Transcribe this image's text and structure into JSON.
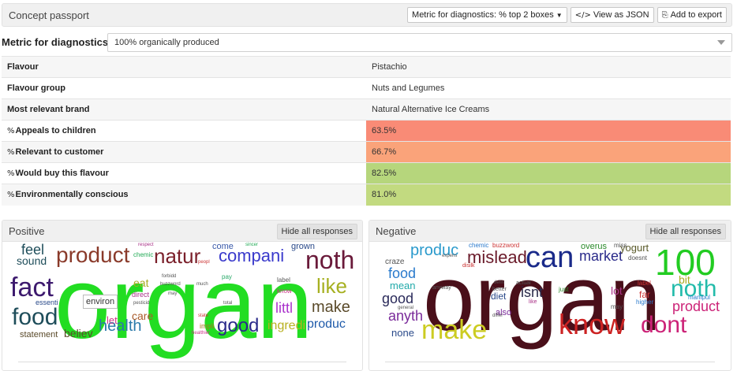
{
  "header": {
    "title": "Concept passport",
    "metric_select_label": "Metric for diagnostics: % top 2 boxes",
    "view_json_label": "View as JSON",
    "export_label": "Add to export"
  },
  "metric": {
    "label": "Metric for diagnostics:",
    "value": "100% organically produced"
  },
  "rows": [
    {
      "key": "Flavour",
      "value": "Pistachio"
    },
    {
      "key": "Flavour group",
      "value": "Nuts and Legumes"
    },
    {
      "key": "Most relevant brand",
      "value": "Natural Alternative Ice Creams"
    },
    {
      "key": "Appeals to children",
      "value": "63.5%",
      "color": "#f98b76"
    },
    {
      "key": "Relevant to customer",
      "value": "66.7%",
      "color": "#faa37a"
    },
    {
      "key": "Would buy this flavour",
      "value": "82.5%",
      "color": "#b6d67c"
    },
    {
      "key": "Environmentally conscious",
      "value": "81.0%",
      "color": "#c2da80"
    }
  ],
  "positive": {
    "title": "Positive",
    "hide_label": "Hide all responses",
    "tooltip": "environ",
    "words": [
      {
        "t": "organ",
        "c": "#22dd22"
      },
      {
        "t": "fact",
        "c": "#3d1a6e"
      },
      {
        "t": "food",
        "c": "#1e4d5a"
      },
      {
        "t": "product",
        "c": "#8a3a2a"
      },
      {
        "t": "natur",
        "c": "#7a1f2a"
      },
      {
        "t": "noth",
        "c": "#6a1a3a"
      },
      {
        "t": "compani",
        "c": "#3a3acc"
      },
      {
        "t": "feel",
        "c": "#1e4d5a"
      },
      {
        "t": "sound",
        "c": "#1e4d5a"
      },
      {
        "t": "like",
        "c": "#a6b020"
      },
      {
        "t": "make",
        "c": "#5a4a2a"
      },
      {
        "t": "good",
        "c": "#2a2a8a"
      },
      {
        "t": "health",
        "c": "#2a7aaa"
      },
      {
        "t": "littl",
        "c": "#aa33cc"
      },
      {
        "t": "ingredi",
        "c": "#b8b020"
      },
      {
        "t": "produc",
        "c": "#1e5aaa"
      },
      {
        "t": "believ",
        "c": "#5a4a2a"
      },
      {
        "t": "statement",
        "c": "#5a4a2a"
      },
      {
        "t": "care",
        "c": "#aa5a2a"
      },
      {
        "t": "let",
        "c": "#cc3388"
      },
      {
        "t": "eat",
        "c": "#aaaa22"
      },
      {
        "t": "direct",
        "c": "#aa3388"
      },
      {
        "t": "come",
        "c": "#3a5aaa"
      },
      {
        "t": "grown",
        "c": "#2a4a8a"
      },
      {
        "t": "essenti",
        "c": "#2a4a8a"
      },
      {
        "t": "label",
        "c": "#555555"
      },
      {
        "t": "know",
        "c": "#cc3388"
      },
      {
        "t": "pay",
        "c": "#2aaa6a"
      },
      {
        "t": "chemic",
        "c": "#22aa55"
      },
      {
        "t": "respect",
        "c": "#aa3388"
      },
      {
        "t": "sincer",
        "c": "#22aa55"
      },
      {
        "t": "peopl",
        "c": "#cc3333"
      },
      {
        "t": "buzzword",
        "c": "#555555"
      },
      {
        "t": "much",
        "c": "#555555"
      },
      {
        "t": "may",
        "c": "#555555"
      },
      {
        "t": "impli",
        "c": "#aa7722"
      },
      {
        "t": "pesticid",
        "c": "#555555"
      },
      {
        "t": "healthier",
        "c": "#cc3388"
      },
      {
        "t": "total",
        "c": "#555555"
      },
      {
        "t": "state",
        "c": "#cc3333"
      },
      {
        "t": "forbidd",
        "c": "#555555"
      }
    ]
  },
  "negative": {
    "title": "Negative",
    "hide_label": "Hide all responses",
    "words": [
      {
        "t": "organ",
        "c": "#4a0f1a"
      },
      {
        "t": "can",
        "c": "#1a2a8a"
      },
      {
        "t": "100",
        "c": "#22cc22"
      },
      {
        "t": "know",
        "c": "#cc2222"
      },
      {
        "t": "dont",
        "c": "#cc2277"
      },
      {
        "t": "make",
        "c": "#cccc22"
      },
      {
        "t": "noth",
        "c": "#22bbaa"
      },
      {
        "t": "product",
        "c": "#cc2277"
      },
      {
        "t": "mislead",
        "c": "#6a1a2a"
      },
      {
        "t": "produc",
        "c": "#2a9acc"
      },
      {
        "t": "market",
        "c": "#2a2a8a"
      },
      {
        "t": "food",
        "c": "#2a7acc"
      },
      {
        "t": "good",
        "c": "#2a2a5a"
      },
      {
        "t": "anyth",
        "c": "#7a2a9a"
      },
      {
        "t": "isnt",
        "c": "#2a2a4a"
      },
      {
        "t": "mean",
        "c": "#22aaaa"
      },
      {
        "t": "none",
        "c": "#2a4a8a"
      },
      {
        "t": "bit",
        "c": "#aaaa22"
      },
      {
        "t": "yogurt",
        "c": "#5a5a2a"
      },
      {
        "t": "overus",
        "c": "#2a8a2a"
      },
      {
        "t": "lot",
        "c": "#aa3388"
      },
      {
        "t": "craze",
        "c": "#555555"
      },
      {
        "t": "diet",
        "c": "#2a4a8a"
      },
      {
        "t": "also",
        "c": "#7a2a9a"
      },
      {
        "t": "chemic",
        "c": "#2a7acc"
      },
      {
        "t": "buzzword",
        "c": "#cc3333"
      },
      {
        "t": "far",
        "c": "#cc3333"
      },
      {
        "t": "miss",
        "c": "#555555"
      },
      {
        "t": "doesnt",
        "c": "#555555"
      },
      {
        "t": "higher",
        "c": "#2a7acc"
      },
      {
        "t": "manipul",
        "c": "#2a7acc"
      },
      {
        "t": "just",
        "c": "#2a8a2a"
      },
      {
        "t": "label",
        "c": "#cc3333"
      },
      {
        "t": "may",
        "c": "#555555"
      },
      {
        "t": "anyway",
        "c": "#555555"
      },
      {
        "t": "better",
        "c": "#555555"
      },
      {
        "t": "actual",
        "c": "#555555"
      },
      {
        "t": "like",
        "c": "#aa3388"
      },
      {
        "t": "defin",
        "c": "#555555"
      },
      {
        "t": "differ",
        "c": "#555555"
      },
      {
        "t": "expens",
        "c": "#555555"
      },
      {
        "t": "disilk",
        "c": "#cc3333"
      },
      {
        "t": "general",
        "c": "#555555"
      }
    ]
  }
}
